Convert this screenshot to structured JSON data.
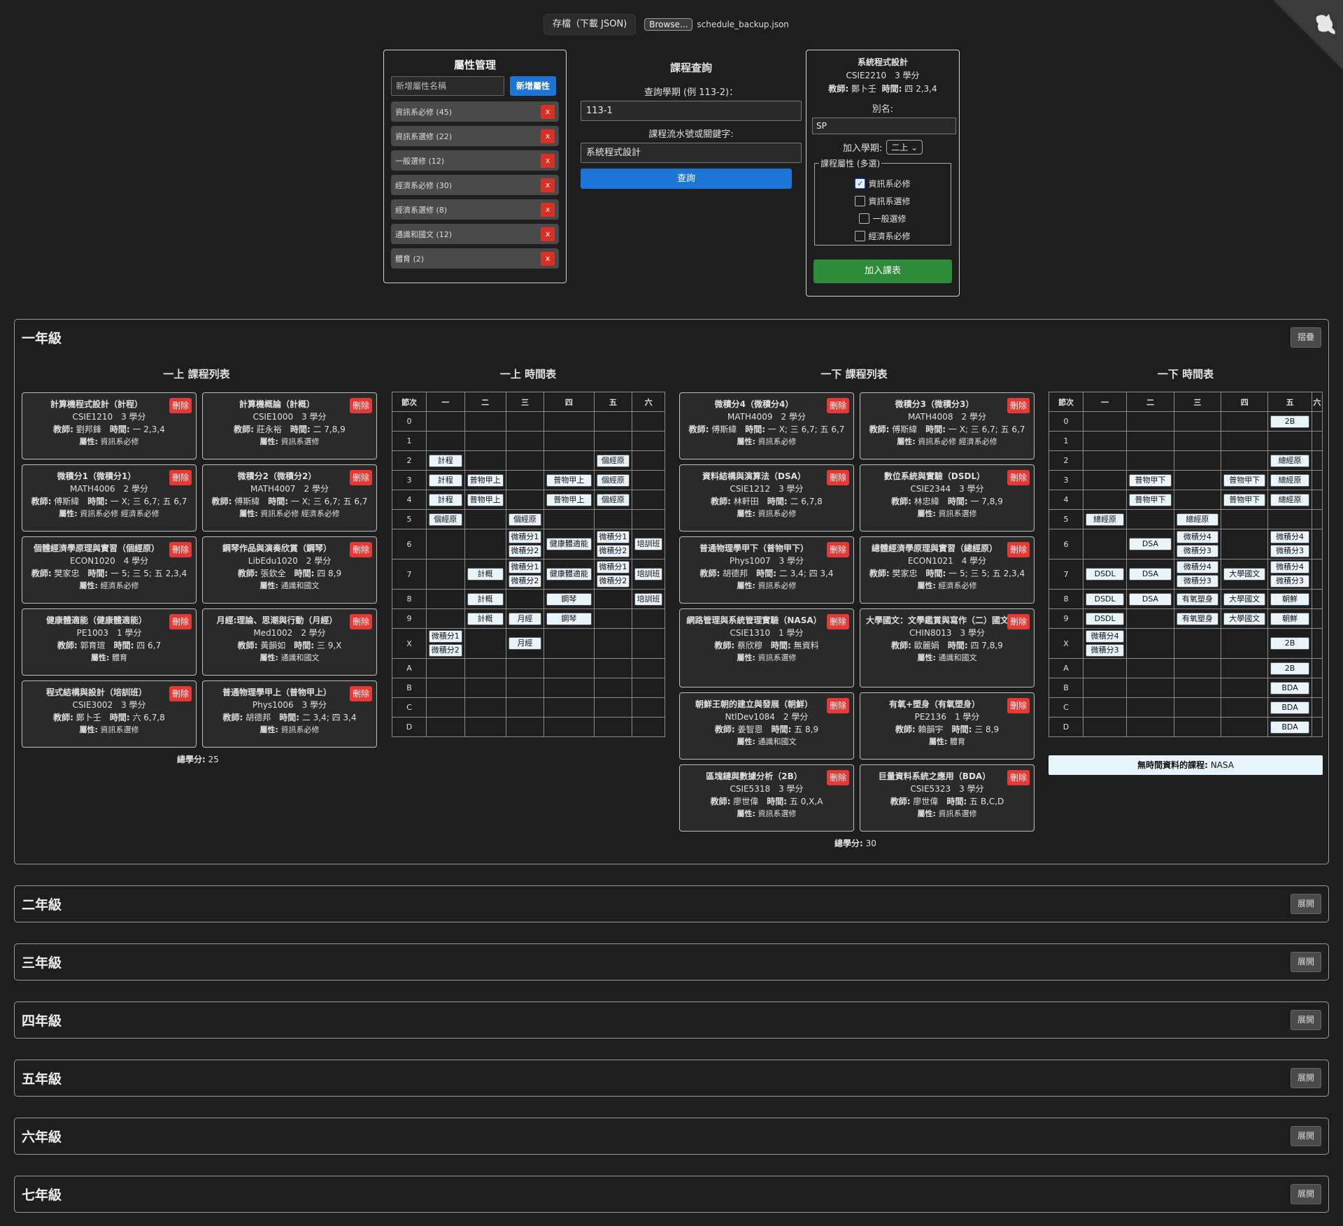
{
  "top": {
    "save_label": "存檔（下載 JSON)",
    "browse_label": "Browse...",
    "file_name": "schedule_backup.json"
  },
  "attr_panel": {
    "title": "屬性管理",
    "input_placeholder": "新增屬性名稱",
    "add_label": "新增屬性",
    "remove_label": "x",
    "items": [
      "資訊系必修 (45)",
      "資訊系選修 (22)",
      "一般選修 (12)",
      "經濟系必修 (30)",
      "經濟系選修 (8)",
      "通識和國文 (12)",
      "體育 (2)"
    ]
  },
  "query": {
    "title": "課程查詢",
    "sem_label": "查詢學期 (例 113-2)：",
    "sem_value": "113-1",
    "kw_label": "課程流水號或關鍵字:",
    "kw_value": "系統程式設計",
    "btn_label": "查詢"
  },
  "detail": {
    "name": "系統程式設計",
    "code_credit": "CSIE2210　3 學分",
    "teacher_label": "教師:",
    "teacher": "鄭卜壬",
    "time_label": "時間:",
    "time": "四 2,3,4",
    "alias_label": "別名:",
    "alias_value": "SP",
    "sem_label": "加入學期:",
    "sem_value": "二上",
    "attr_legend": "課程屬性 (多選)",
    "attrs": [
      {
        "label": "資訊系必修",
        "checked": true
      },
      {
        "label": "資訊系選修",
        "checked": false
      },
      {
        "label": "一般選修",
        "checked": false
      },
      {
        "label": "經濟系必修",
        "checked": false
      }
    ],
    "add_label": "加入課表"
  },
  "labels": {
    "teacher": "教師:",
    "time": "時間:",
    "attr": "屬性:",
    "delete": "刪除",
    "total": "總學分:",
    "notime": "無時間資料的課程:"
  },
  "year1": {
    "title": "一年級",
    "toggle": "摺疊",
    "fall_list_title": "一上 課程列表",
    "fall_tt_title": "一上 時間表",
    "spring_list_title": "一下 課程列表",
    "spring_tt_title": "一下 時間表",
    "fall_total": "25",
    "spring_total": "30",
    "spring_notime": "NASA",
    "fall_courses": [
      {
        "name": "計算機程式設計（計程）",
        "cc": "CSIE1210　3 學分",
        "teacher": "劉邦鋒",
        "time": "一 2,3,4",
        "attrs": "資訊系必修"
      },
      {
        "name": "計算機概論（計概）",
        "cc": "CSIE1000　3 學分",
        "teacher": "莊永裕",
        "time": "二 7,8,9",
        "attrs": "資訊系選修"
      },
      {
        "name": "微積分1（微積分1）",
        "cc": "MATH4006　2 學分",
        "teacher": "傅斯緯",
        "time": "一 X; 三 6,7; 五 6,7",
        "attrs": "資訊系必修 經濟系必修"
      },
      {
        "name": "微積分2（微積分2）",
        "cc": "MATH4007　2 學分",
        "teacher": "傅斯緯",
        "time": "一 X; 三 6,7; 五 6,7",
        "attrs": "資訊系必修 經濟系必修"
      },
      {
        "name": "個體經濟學原理與實習（個經原）",
        "cc": "ECON1020　4 學分",
        "teacher": "樊家忠",
        "time": "一 5; 三 5; 五 2,3,4",
        "attrs": "經濟系必修"
      },
      {
        "name": "鋼琴作品與演奏欣賞（鋼琴）",
        "cc": "LibEdu1020　2 學分",
        "teacher": "張欽全",
        "time": "四 8,9",
        "attrs": "通識和國文"
      },
      {
        "name": "健康體適能（健康體適能）",
        "cc": "PE1003　1 學分",
        "teacher": "郭育瑄",
        "time": "四 6,7",
        "attrs": "體育"
      },
      {
        "name": "月經:理論、思潮與行動（月經）",
        "cc": "Med1002　2 學分",
        "teacher": "黃韻如",
        "time": "三 9,X",
        "attrs": "通識和國文"
      },
      {
        "name": "程式結構與設計（培訓班）",
        "cc": "CSIE3002　3 學分",
        "teacher": "鄭卜壬",
        "time": "六 6,7,8",
        "attrs": "資訊系選修"
      },
      {
        "name": "普通物理學甲上（普物甲上）",
        "cc": "Phys1006　3 學分",
        "teacher": "胡德邦",
        "time": "二 3,4; 四 3,4",
        "attrs": "資訊系必修"
      }
    ],
    "spring_courses": [
      {
        "name": "微積分4（微積分4）",
        "cc": "MATH4009　2 學分",
        "teacher": "傅斯緯",
        "time": "一 X; 三 6,7; 五 6,7",
        "attrs": "資訊系必修"
      },
      {
        "name": "微積分3（微積分3）",
        "cc": "MATH4008　2 學分",
        "teacher": "傅斯緯",
        "time": "一 X; 三 6,7; 五 6,7",
        "attrs": "資訊系必修 經濟系必修"
      },
      {
        "name": "資料結構與演算法（DSA）",
        "cc": "CSIE1212　3 學分",
        "teacher": "林軒田",
        "time": "二 6,7,8",
        "attrs": "資訊系必修"
      },
      {
        "name": "數位系統與實驗（DSDL）",
        "cc": "CSIE2344　3 學分",
        "teacher": "林忠緯",
        "time": "一 7,8,9",
        "attrs": "資訊系選修"
      },
      {
        "name": "普通物理學甲下（普物甲下）",
        "cc": "Phys1007　3 學分",
        "teacher": "胡德邦",
        "time": "二 3,4; 四 3,4",
        "attrs": "資訊系必修"
      },
      {
        "name": "總體經濟學原理與實習（總經原）",
        "cc": "ECON1021　4 學分",
        "teacher": "樊家忠",
        "time": "一 5; 三 5; 五 2,3,4",
        "attrs": "經濟系必修"
      },
      {
        "name": "網路管理與系統管理實驗（NASA）",
        "cc": "CSIE1310　1 學分",
        "teacher": "蔡欣穆",
        "time": "無資料",
        "attrs": "資訊系選修"
      },
      {
        "name": "大學國文：文學鑑賞與寫作（二）國文)",
        "cc": "CHIN8013　3 學分",
        "teacher": "歐麗娟",
        "time": "四 7,8,9",
        "attrs": "通識和國文"
      },
      {
        "name": "朝鮮王朝的建立與發展（朝鮮）",
        "cc": "NtlDev1084　2 學分",
        "teacher": "姜智恩",
        "time": "五 8,9",
        "attrs": "通識和國文"
      },
      {
        "name": "有氧+塑身（有氧塑身）",
        "cc": "PE2136　1 學分",
        "teacher": "賴韻宇",
        "time": "三 8,9",
        "attrs": "體育"
      },
      {
        "name": "區塊鏈與數據分析（2B）",
        "cc": "CSIE5318　3 學分",
        "teacher": "廖世偉",
        "time": "五 0,X,A",
        "attrs": "資訊系選修"
      },
      {
        "name": "巨量資料系統之應用（BDA）",
        "cc": "CSIE5323　3 學分",
        "teacher": "廖世偉",
        "time": "五 B,C,D",
        "attrs": "資訊系選修"
      }
    ],
    "fall_tt": {
      "days": [
        "節次",
        "一",
        "二",
        "三",
        "四",
        "五",
        "六"
      ],
      "rows": [
        [
          "0",
          [],
          [],
          [],
          [],
          [],
          []
        ],
        [
          "1",
          [],
          [],
          [],
          [],
          [],
          []
        ],
        [
          "2",
          [
            "計程"
          ],
          [],
          [],
          [],
          [
            "個經原"
          ],
          []
        ],
        [
          "3",
          [
            "計程"
          ],
          [
            "普物甲上"
          ],
          [],
          [
            "普物甲上"
          ],
          [
            "個經原"
          ],
          []
        ],
        [
          "4",
          [
            "計程"
          ],
          [
            "普物甲上"
          ],
          [],
          [
            "普物甲上"
          ],
          [
            "個經原"
          ],
          []
        ],
        [
          "5",
          [
            "個經原"
          ],
          [],
          [
            "個經原"
          ],
          [],
          [],
          []
        ],
        [
          "6",
          [],
          [],
          [
            "微積分1",
            "微積分2"
          ],
          [
            "健康體適能"
          ],
          [
            "微積分1",
            "微積分2"
          ],
          [
            "培訓班"
          ]
        ],
        [
          "7",
          [],
          [
            "計概"
          ],
          [
            "微積分1",
            "微積分2"
          ],
          [
            "健康體適能"
          ],
          [
            "微積分1",
            "微積分2"
          ],
          [
            "培訓班"
          ]
        ],
        [
          "8",
          [],
          [
            "計概"
          ],
          [],
          [
            "鋼琴"
          ],
          [],
          [
            "培訓班"
          ]
        ],
        [
          "9",
          [],
          [
            "計概"
          ],
          [
            "月經"
          ],
          [
            "鋼琴"
          ],
          [],
          []
        ],
        [
          "X",
          [
            "微積分1",
            "微積分2"
          ],
          [],
          [
            "月經"
          ],
          [],
          [],
          []
        ],
        [
          "A",
          [],
          [],
          [],
          [],
          [],
          []
        ],
        [
          "B",
          [],
          [],
          [],
          [],
          [],
          []
        ],
        [
          "C",
          [],
          [],
          [],
          [],
          [],
          []
        ],
        [
          "D",
          [],
          [],
          [],
          [],
          [],
          []
        ]
      ]
    },
    "spring_tt": {
      "days": [
        "節次",
        "一",
        "二",
        "三",
        "四",
        "五",
        "六"
      ],
      "rows": [
        [
          "0",
          [],
          [],
          [],
          [],
          [
            "2B"
          ],
          []
        ],
        [
          "1",
          [],
          [],
          [],
          [],
          [],
          []
        ],
        [
          "2",
          [],
          [],
          [],
          [],
          [
            "總經原"
          ],
          []
        ],
        [
          "3",
          [],
          [
            "普物甲下"
          ],
          [],
          [
            "普物甲下"
          ],
          [
            "總經原"
          ],
          []
        ],
        [
          "4",
          [],
          [
            "普物甲下"
          ],
          [],
          [
            "普物甲下"
          ],
          [
            "總經原"
          ],
          []
        ],
        [
          "5",
          [
            "總經原"
          ],
          [],
          [
            "總經原"
          ],
          [],
          [],
          []
        ],
        [
          "6",
          [],
          [
            "DSA"
          ],
          [
            "微積分4",
            "微積分3"
          ],
          [],
          [
            "微積分4",
            "微積分3"
          ],
          []
        ],
        [
          "7",
          [
            "DSDL"
          ],
          [
            "DSA"
          ],
          [
            "微積分4",
            "微積分3"
          ],
          [
            "大學國文"
          ],
          [
            "微積分4",
            "微積分3"
          ],
          []
        ],
        [
          "8",
          [
            "DSDL"
          ],
          [
            "DSA"
          ],
          [
            "有氧塑身"
          ],
          [
            "大學國文"
          ],
          [
            "朝鮮"
          ],
          []
        ],
        [
          "9",
          [
            "DSDL"
          ],
          [],
          [
            "有氧塑身"
          ],
          [
            "大學國文"
          ],
          [
            "朝鮮"
          ],
          []
        ],
        [
          "X",
          [
            "微積分4",
            "微積分3"
          ],
          [],
          [],
          [],
          [
            "2B"
          ],
          []
        ],
        [
          "A",
          [],
          [],
          [],
          [],
          [
            "2B"
          ],
          []
        ],
        [
          "B",
          [],
          [],
          [],
          [],
          [
            "BDA"
          ],
          []
        ],
        [
          "C",
          [],
          [],
          [],
          [],
          [
            "BDA"
          ],
          []
        ],
        [
          "D",
          [],
          [],
          [],
          [],
          [
            "BDA"
          ],
          []
        ]
      ]
    }
  },
  "collapsed_years": [
    {
      "title": "二年級",
      "toggle": "展開"
    },
    {
      "title": "三年級",
      "toggle": "展開"
    },
    {
      "title": "四年級",
      "toggle": "展開"
    },
    {
      "title": "五年級",
      "toggle": "展開"
    },
    {
      "title": "六年級",
      "toggle": "展開"
    },
    {
      "title": "七年級",
      "toggle": "展開"
    }
  ]
}
